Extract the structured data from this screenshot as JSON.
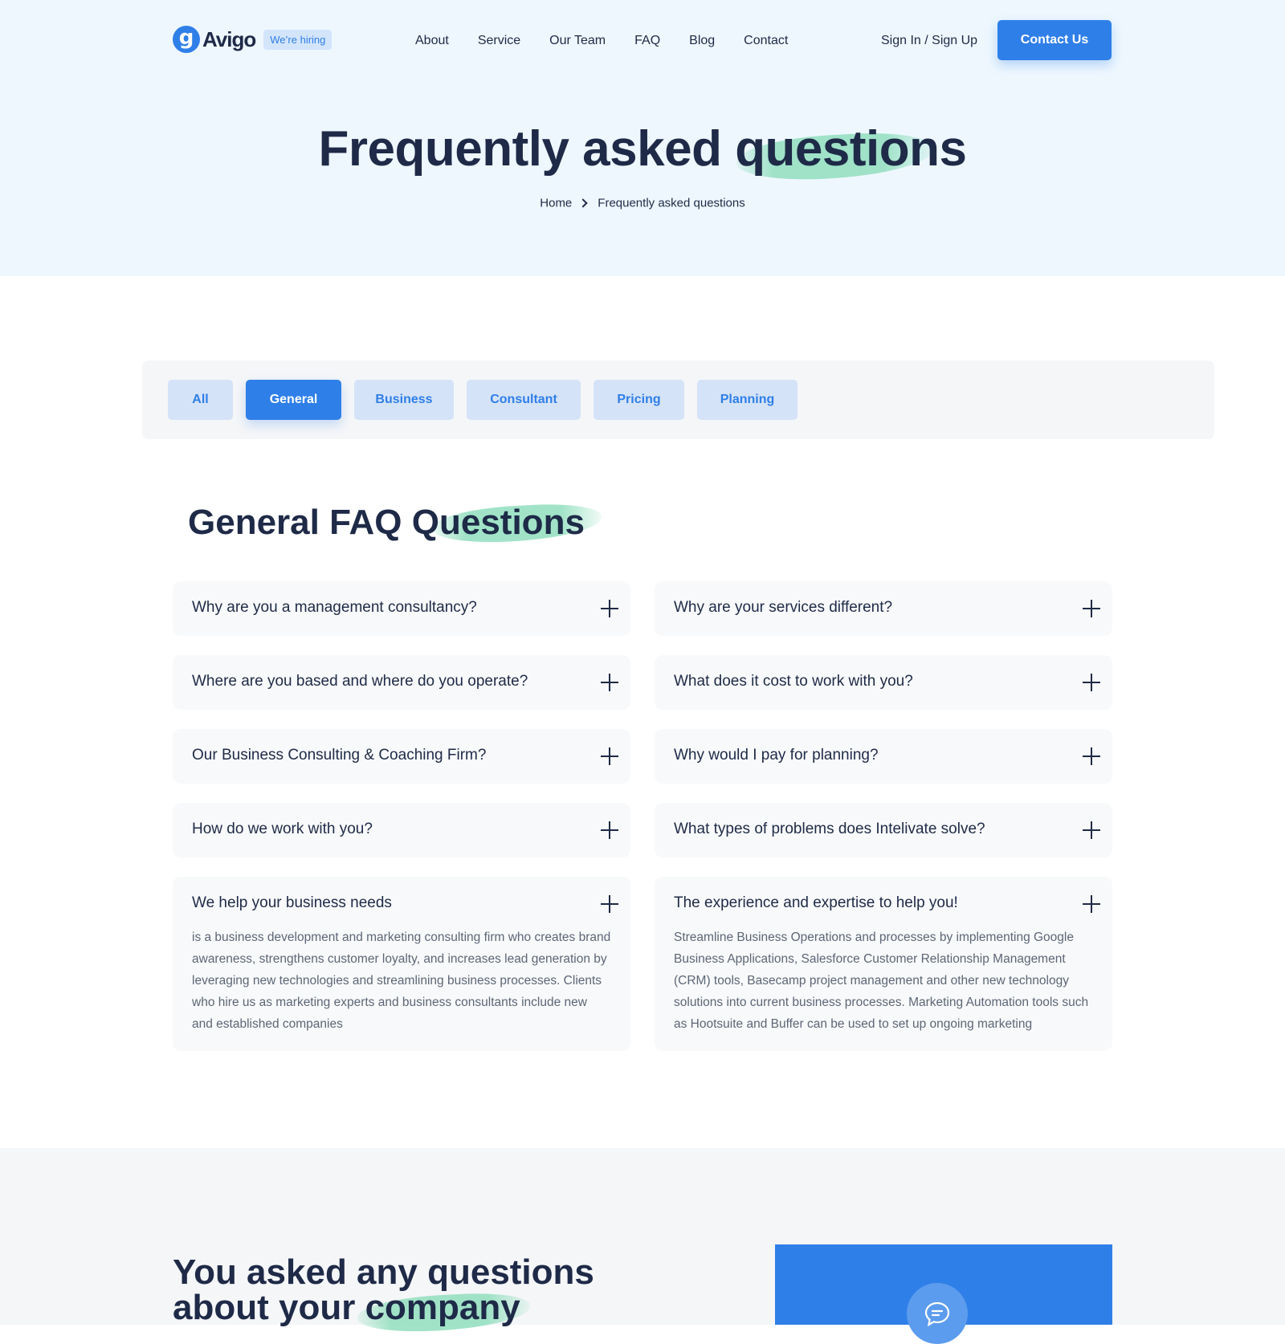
{
  "header": {
    "logo_glyph": "g",
    "logo_text": "Avigo",
    "hiring_badge": "We’re hiring",
    "nav": [
      "About",
      "Service",
      "Our Team",
      "FAQ",
      "Blog",
      "Contact"
    ],
    "signin": "Sign In / Sign Up",
    "contact_button": "Contact Us"
  },
  "hero": {
    "title_start": "Frequently asked ",
    "title_highlight": "questions",
    "breadcrumb": [
      "Home",
      "Frequently asked questions"
    ]
  },
  "filters": {
    "tabs": [
      "All",
      "General",
      "Business",
      "Consultant",
      "Pricing",
      "Planning"
    ],
    "active": "General"
  },
  "faq_section": {
    "title_start": "General FAQ ",
    "title_highlight": "Questions",
    "left": [
      {
        "question": "Why are you a management consultancy?"
      },
      {
        "question": "Where are you based and where do you operate?"
      },
      {
        "question": "Our Business Consulting & Coaching Firm?"
      },
      {
        "question": "How do we work with you?"
      },
      {
        "question": "We help your business needs",
        "answer": "is a business development and marketing consulting firm who creates brand awareness, strengthens customer loyalty, and increases lead generation by leveraging new technologies and streamlining business processes. Clients who hire us as marketing experts and business consultants include new and established companies"
      }
    ],
    "right": [
      {
        "question": "Why are your services different?"
      },
      {
        "question": "What does it cost to work with you?"
      },
      {
        "question": "Why would I pay for planning?"
      },
      {
        "question": "What types of problems does Intelivate solve?"
      },
      {
        "question": "The experience and expertise to help you!",
        "answer": "Streamline Business Operations and processes by implementing Google Business Applications, Salesforce Customer Relationship Management (CRM) tools, Basecamp project management and other new technology solutions into current business processes. Marketing Automation tools such as Hootsuite and Buffer can be used to set up ongoing marketing"
      }
    ]
  },
  "bottom": {
    "title_line1": "You asked any questions",
    "title_line2_start": "about your ",
    "title_line2_highlight": "company"
  },
  "colors": {
    "primary": "#2f7fe8",
    "heading": "#1e2a47",
    "hero_bg": "#eef7fe",
    "brush": "#91debe",
    "tab_bg": "#d5e3f8"
  },
  "icons": [
    "chevron-right-icon",
    "plus-icon",
    "chat-icon"
  ]
}
